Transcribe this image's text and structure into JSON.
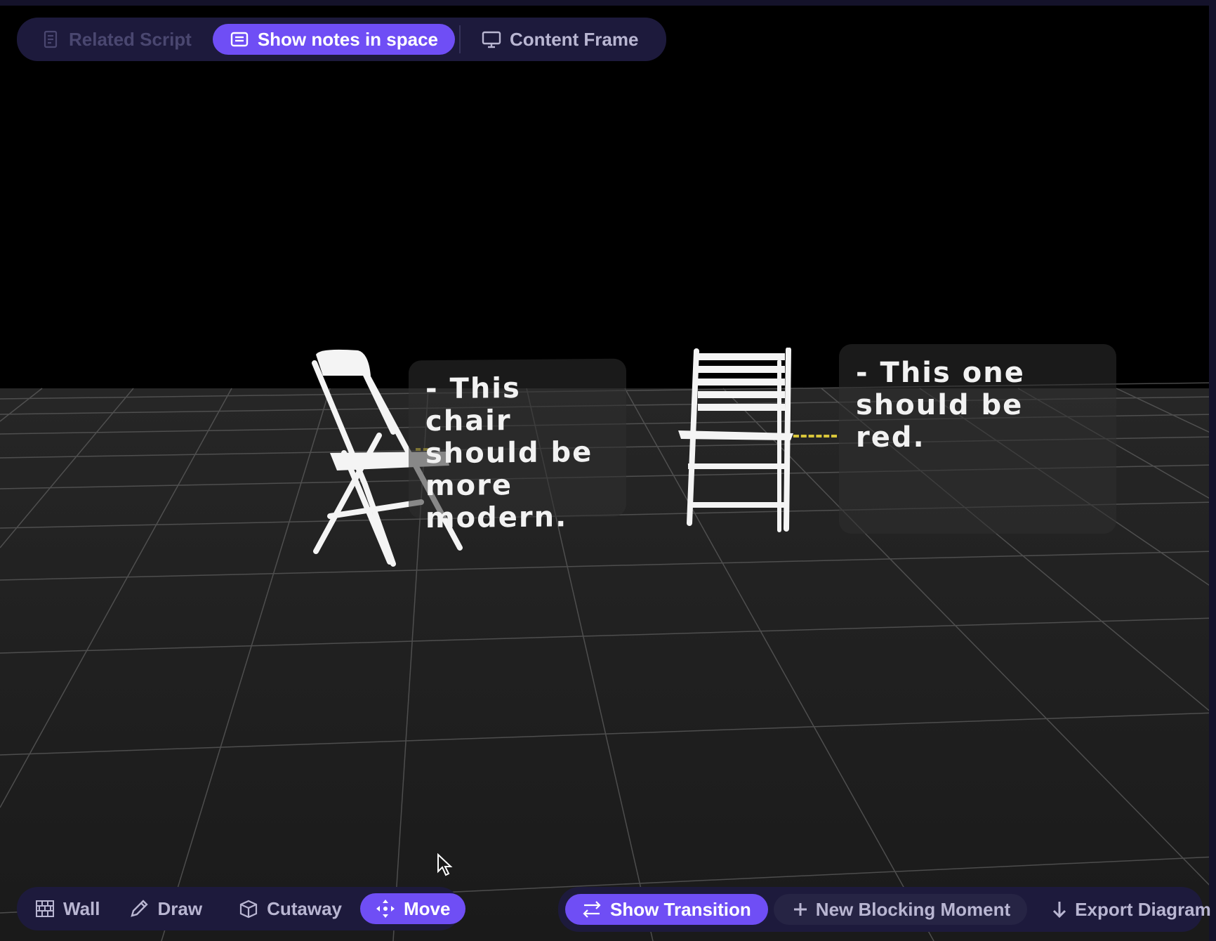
{
  "top_toolbar": {
    "related_script": "Related Script",
    "show_notes": "Show notes in space",
    "content_frame": "Content Frame"
  },
  "notes": [
    {
      "lines": [
        "- This chair",
        "should be",
        "more",
        "modern."
      ]
    },
    {
      "lines": [
        "- This one",
        "should be",
        "red."
      ]
    }
  ],
  "bottom_left_toolbar": {
    "wall": "Wall",
    "draw": "Draw",
    "cutaway": "Cutaway",
    "move": "Move"
  },
  "bottom_right_toolbar": {
    "show_transition": "Show Transition",
    "new_blocking_moment": "New Blocking Moment",
    "export_diagram": "Export Diagram"
  },
  "icons": {
    "related_script": "document-icon",
    "show_notes": "notes-icon",
    "content_frame": "monitor-icon",
    "wall": "brick-wall-icon",
    "draw": "pencil-icon",
    "cutaway": "cube-cutaway-icon",
    "move": "move-arrows-icon",
    "show_transition": "transition-icon",
    "new_blocking_moment": "plus-icon",
    "export_diagram": "arrow-down-icon"
  },
  "colors": {
    "accent": "#6f4ef5",
    "toolbar_bg": "#1d1a3c",
    "leader_line": "#d9c63a"
  }
}
